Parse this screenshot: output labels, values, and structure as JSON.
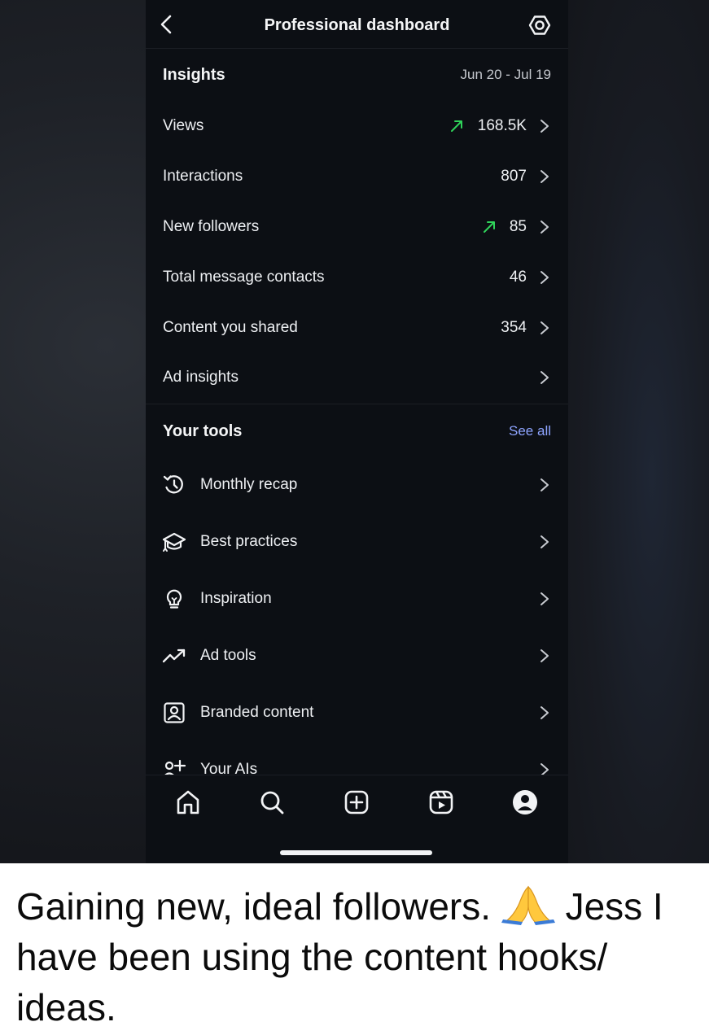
{
  "header": {
    "title": "Professional dashboard"
  },
  "insights": {
    "title": "Insights",
    "date_range": "Jun 20 - Jul 19",
    "rows": [
      {
        "label": "Views",
        "value": "168.5K",
        "trend": "up"
      },
      {
        "label": "Interactions",
        "value": "807",
        "trend": "none"
      },
      {
        "label": "New followers",
        "value": "85",
        "trend": "up"
      },
      {
        "label": "Total message contacts",
        "value": "46",
        "trend": "none"
      },
      {
        "label": "Content you shared",
        "value": "354",
        "trend": "none"
      },
      {
        "label": "Ad insights",
        "value": "",
        "trend": "none"
      }
    ]
  },
  "tools": {
    "title": "Your tools",
    "see_all": "See all",
    "items": [
      {
        "label": "Monthly recap",
        "icon": "history-icon"
      },
      {
        "label": "Best practices",
        "icon": "graduation-cap-icon"
      },
      {
        "label": "Inspiration",
        "icon": "lightbulb-icon"
      },
      {
        "label": "Ad tools",
        "icon": "trend-up-icon"
      },
      {
        "label": "Branded content",
        "icon": "branded-content-icon"
      },
      {
        "label": "Your AIs",
        "icon": "ai-person-sparkle-icon"
      }
    ]
  },
  "tabbar": {
    "tabs": [
      {
        "name": "home",
        "icon": "home-icon"
      },
      {
        "name": "search",
        "icon": "search-icon"
      },
      {
        "name": "create",
        "icon": "plus-square-icon"
      },
      {
        "name": "reels",
        "icon": "reels-icon"
      },
      {
        "name": "profile",
        "icon": "profile-icon"
      }
    ]
  },
  "caption": {
    "text_before": "Gaining new, ideal followers.",
    "emoji": "folded-hands-emoji",
    "text_after": "Jess I have been using the content hooks/ ideas."
  },
  "colors": {
    "background": "#0c0f14",
    "text": "#f2f3f5",
    "accent_link": "#8ea4ff",
    "trend_up": "#2fd35a"
  }
}
